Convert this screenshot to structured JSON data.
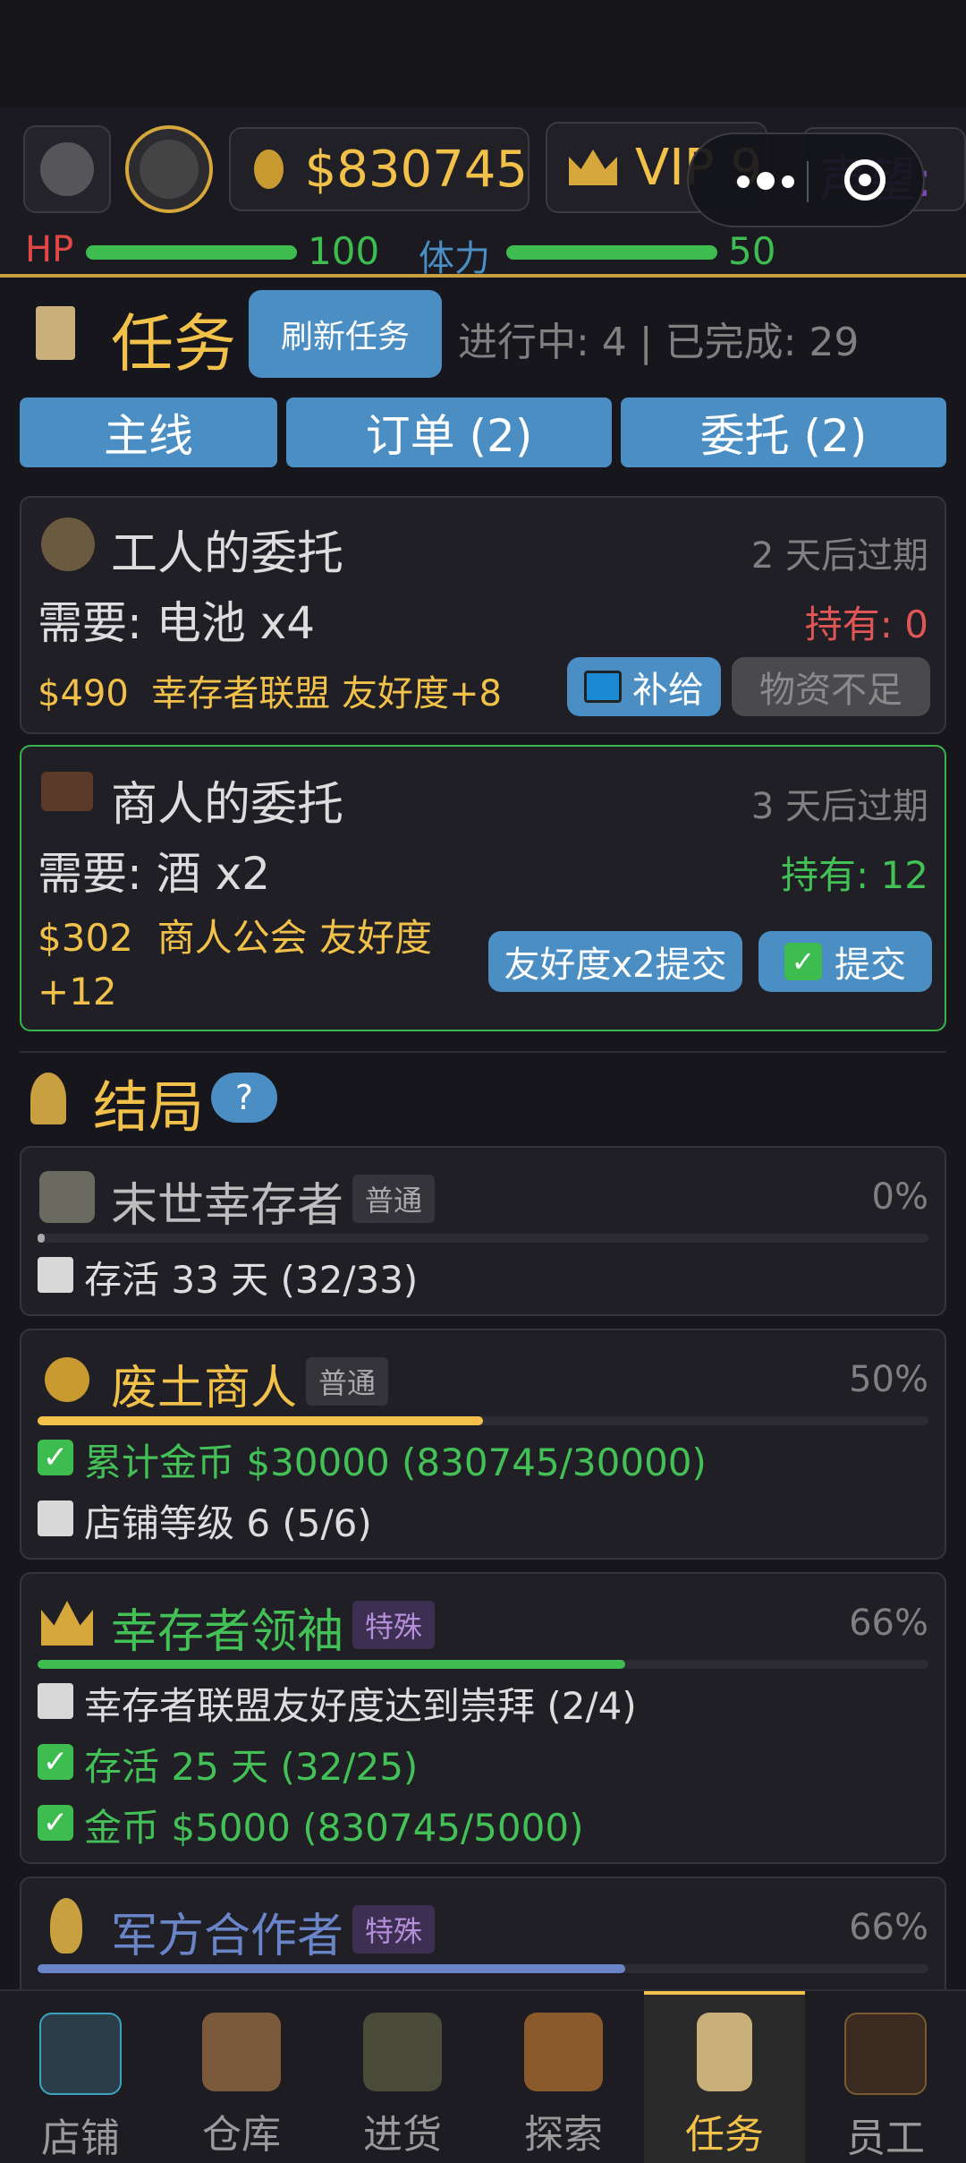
{
  "header": {
    "money": "$830745",
    "vip": "VIP 9",
    "reputation_label": "声望:",
    "hp_label": "HP",
    "hp_value": "100",
    "hp_fraction": 1.0,
    "stamina_label": "体力",
    "stamina_value": "50",
    "stamina_fraction": 1.0
  },
  "tasks": {
    "title": "任务",
    "refresh_label": "刷新任务",
    "status": "进行中: 4 | 已完成: 29",
    "tabs": [
      "主线",
      "订单 (2)",
      "委托 (2)"
    ]
  },
  "commissions": [
    {
      "title": "工人的委托",
      "expires": "2 天后过期",
      "need": "需要: 电池 x4",
      "have": "持有: 0",
      "reward": "$490  幸存者联盟 友好度+8",
      "supply_label": "补给",
      "status_label": "物资不足"
    },
    {
      "title": "商人的委托",
      "expires": "3 天后过期",
      "need": "需要: 酒 x2",
      "have": "持有: 12",
      "reward": "$302  商人公会 友好度+12",
      "double_label": "友好度x2提交",
      "submit_label": "提交"
    }
  ],
  "endings": {
    "title": "结局",
    "help": "?",
    "items": [
      {
        "name": "末世幸存者",
        "tag": "普通",
        "percent": "0%",
        "progress": 0.0,
        "conditions": [
          {
            "text": "存活 33 天 (32/33)",
            "done": false
          }
        ]
      },
      {
        "name": "废土商人",
        "tag": "普通",
        "percent": "50%",
        "progress": 0.5,
        "conditions": [
          {
            "text": "累计金币 $30000 (830745/30000)",
            "done": true
          },
          {
            "text": "店铺等级 6 (5/6)",
            "done": false
          }
        ]
      },
      {
        "name": "幸存者领袖",
        "tag": "特殊",
        "percent": "66%",
        "progress": 0.66,
        "conditions": [
          {
            "text": "幸存者联盟友好度达到崇拜 (2/4)",
            "done": false
          },
          {
            "text": "存活 25 天 (32/25)",
            "done": true
          },
          {
            "text": "金币 $5000 (830745/5000)",
            "done": true
          }
        ]
      },
      {
        "name": "军方合作者",
        "tag": "特殊",
        "percent": "66%",
        "progress": 0.66,
        "conditions": []
      }
    ]
  },
  "nav": {
    "items": [
      "店铺",
      "仓库",
      "进货",
      "探索",
      "任务",
      "员工"
    ],
    "active": "任务"
  },
  "colors": {
    "accent_gold": "#f2c14a",
    "button_blue": "#4a8ec4",
    "success_green": "#3dbd4f",
    "danger_red": "#e05555",
    "ending_purple_bar": "#6a84c8"
  }
}
